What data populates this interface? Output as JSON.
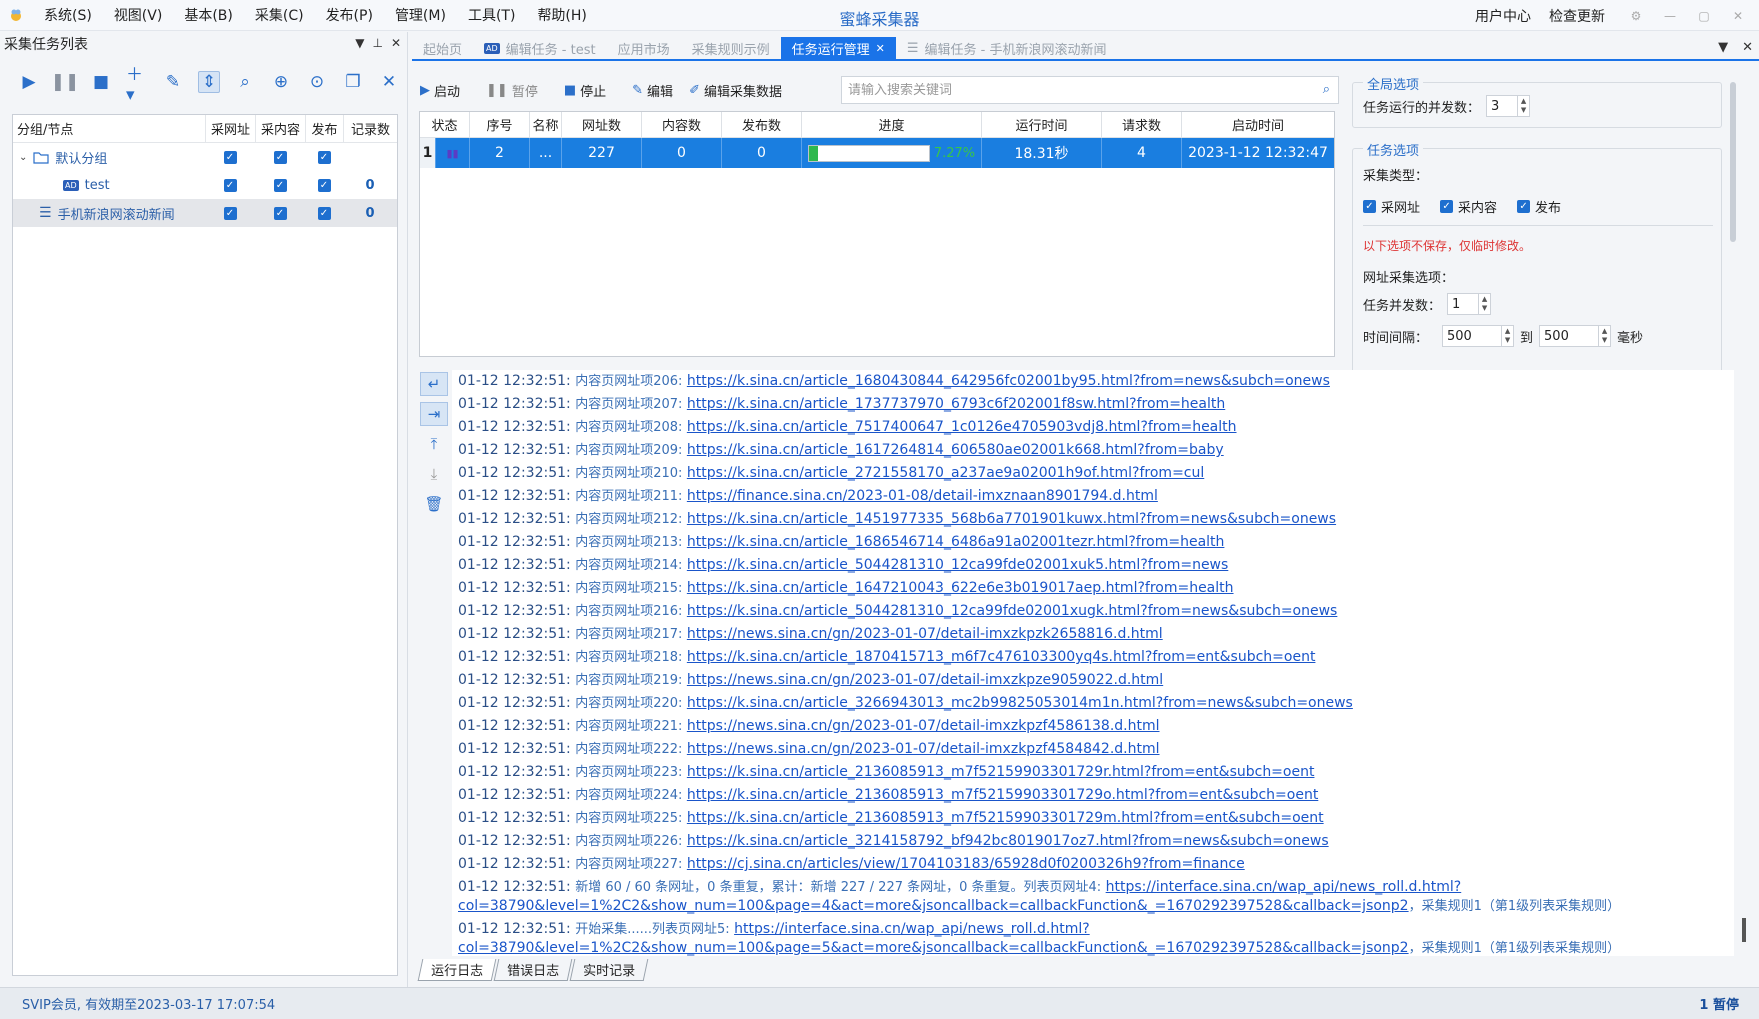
{
  "app": {
    "title": "蜜蜂采集器"
  },
  "menu": [
    "系统(S)",
    "视图(V)",
    "基本(B)",
    "采集(C)",
    "发布(P)",
    "管理(M)",
    "工具(T)",
    "帮助(H)"
  ],
  "title_links": {
    "user_center": "用户中心",
    "check_update": "检查更新"
  },
  "left": {
    "title": "采集任务列表",
    "tree_headers": {
      "node": "分组/节点",
      "url": "采网址",
      "content": "采内容",
      "publish": "发布",
      "records": "记录数"
    },
    "nodes": [
      {
        "name": "默认分组",
        "records": ""
      },
      {
        "name": "test",
        "records": "0"
      },
      {
        "name": "手机新浪网滚动新闻",
        "records": "0"
      }
    ]
  },
  "tabs": {
    "home": "起始页",
    "edit_test": "编辑任务 - test",
    "market": "应用市场",
    "examples": "采集规则示例",
    "runner": "任务运行管理",
    "edit_sina": "编辑任务 - 手机新浪网滚动新闻"
  },
  "task_toolbar": {
    "start": "启动",
    "pause": "暂停",
    "stop": "停止",
    "edit": "编辑",
    "edit_data": "编辑采集数据",
    "search_placeholder": "请输入搜索关键词"
  },
  "grid": {
    "headers": {
      "status": "状态",
      "seq": "序号",
      "name": "名称",
      "urls": "网址数",
      "contents": "内容数",
      "published": "发布数",
      "progress": "进度",
      "runtime": "运行时间",
      "requests": "请求数",
      "start_time": "启动时间"
    },
    "row": {
      "index": "1",
      "seq": "2",
      "name": "...",
      "urls": "227",
      "contents": "0",
      "published": "0",
      "progress_text": "7.27%",
      "progress_value": 7.27,
      "runtime": "18.31秒",
      "requests": "4",
      "start_time": "2023-1-12 12:32:47"
    }
  },
  "options": {
    "global_title": "全局选项",
    "concurrency_label": "任务运行的并发数：",
    "concurrency_value": "3",
    "task_title": "任务选项",
    "collect_type_label": "采集类型：",
    "chk_url": "采网址",
    "chk_content": "采内容",
    "chk_publish": "发布",
    "warning": "以下选项不保存，仅临时修改。",
    "url_options_label": "网址采集选项：",
    "task_concurrency_label": "任务并发数：",
    "task_concurrency_value": "1",
    "interval_label": "时间间隔：",
    "interval_from": "500",
    "to_label": "到",
    "interval_to": "500",
    "unit_label": "毫秒"
  },
  "log": {
    "lines": [
      {
        "time": "01-12 12:32:51:",
        "label": "内容页网址项206:",
        "url": "https://k.sina.cn/article_1680430844_642956fc02001by95.html?from=news&subch=onews"
      },
      {
        "time": "01-12 12:32:51:",
        "label": "内容页网址项207:",
        "url": "https://k.sina.cn/article_1737737970_6793c6f202001f8sw.html?from=health"
      },
      {
        "time": "01-12 12:32:51:",
        "label": "内容页网址项208:",
        "url": "https://k.sina.cn/article_7517400647_1c0126e4705903vdj8.html?from=health"
      },
      {
        "time": "01-12 12:32:51:",
        "label": "内容页网址项209:",
        "url": "https://k.sina.cn/article_1617264814_606580ae02001k668.html?from=baby"
      },
      {
        "time": "01-12 12:32:51:",
        "label": "内容页网址项210:",
        "url": "https://k.sina.cn/article_2721558170_a237ae9a02001h9of.html?from=cul"
      },
      {
        "time": "01-12 12:32:51:",
        "label": "内容页网址项211:",
        "url": "https://finance.sina.cn/2023-01-08/detail-imxznaan8901794.d.html"
      },
      {
        "time": "01-12 12:32:51:",
        "label": "内容页网址项212:",
        "url": "https://k.sina.cn/article_1451977335_568b6a7701901kuwx.html?from=news&subch=onews"
      },
      {
        "time": "01-12 12:32:51:",
        "label": "内容页网址项213:",
        "url": "https://k.sina.cn/article_1686546714_6486a91a02001tezr.html?from=health"
      },
      {
        "time": "01-12 12:32:51:",
        "label": "内容页网址项214:",
        "url": "https://k.sina.cn/article_5044281310_12ca99fde02001xuk5.html?from=news"
      },
      {
        "time": "01-12 12:32:51:",
        "label": "内容页网址项215:",
        "url": "https://k.sina.cn/article_1647210043_622e6e3b019017aep.html?from=health"
      },
      {
        "time": "01-12 12:32:51:",
        "label": "内容页网址项216:",
        "url": "https://k.sina.cn/article_5044281310_12ca99fde02001xugk.html?from=news&subch=onews"
      },
      {
        "time": "01-12 12:32:51:",
        "label": "内容页网址项217:",
        "url": "https://news.sina.cn/gn/2023-01-07/detail-imxzkpzk2658816.d.html"
      },
      {
        "time": "01-12 12:32:51:",
        "label": "内容页网址项218:",
        "url": "https://k.sina.cn/article_1870415713_m6f7c476103300yq4s.html?from=ent&subch=oent"
      },
      {
        "time": "01-12 12:32:51:",
        "label": "内容页网址项219:",
        "url": "https://news.sina.cn/gn/2023-01-07/detail-imxzkpze9059022.d.html"
      },
      {
        "time": "01-12 12:32:51:",
        "label": "内容页网址项220:",
        "url": "https://k.sina.cn/article_3266943013_mc2b99825053014m1n.html?from=news&subch=onews"
      },
      {
        "time": "01-12 12:32:51:",
        "label": "内容页网址项221:",
        "url": "https://news.sina.cn/gn/2023-01-07/detail-imxzkpzf4586138.d.html"
      },
      {
        "time": "01-12 12:32:51:",
        "label": "内容页网址项222:",
        "url": "https://news.sina.cn/gn/2023-01-07/detail-imxzkpzf4584842.d.html"
      },
      {
        "time": "01-12 12:32:51:",
        "label": "内容页网址项223:",
        "url": "https://k.sina.cn/article_2136085913_m7f52159903301729r.html?from=ent&subch=oent"
      },
      {
        "time": "01-12 12:32:51:",
        "label": "内容页网址项224:",
        "url": "https://k.sina.cn/article_2136085913_m7f52159903301729o.html?from=ent&subch=oent"
      },
      {
        "time": "01-12 12:32:51:",
        "label": "内容页网址项225:",
        "url": "https://k.sina.cn/article_2136085913_m7f52159903301729m.html?from=ent&subch=oent"
      },
      {
        "time": "01-12 12:32:51:",
        "label": "内容页网址项226:",
        "url": "https://k.sina.cn/article_3214158792_bf942bc8019017oz7.html?from=news&subch=onews"
      },
      {
        "time": "01-12 12:32:51:",
        "label": "内容页网址项227:",
        "url": "https://cj.sina.cn/articles/view/1704103183/65928d0f0200326h9?from=finance"
      }
    ],
    "summary1": {
      "time": "01-12 12:32:51:",
      "text": "新增 60 / 60 条网址，0 条重复，累计：新增 227 / 227 条网址，0 条重复。列表页网址4:",
      "url": "https://interface.sina.cn/wap_api/news_roll.d.html?col=38790&level=1%2C2&show_num=100&page=4&act=more&jsoncallback=callbackFunction&_=1670292397528&callback=jsonp2",
      "tail": "，采集规则1（第1级列表采集规则）"
    },
    "summary2": {
      "time": "01-12 12:32:51:",
      "text": "开始采集......列表页网址5:",
      "url": "https://interface.sina.cn/wap_api/news_roll.d.html?col=38790&level=1%2C2&show_num=100&page=5&act=more&jsoncallback=callbackFunction&_=1670292397528&callback=jsonp2",
      "tail": "，采集规则1（第1级列表采集规则）"
    }
  },
  "bottom_tabs": {
    "run_log": "运行日志",
    "error_log": "错误日志",
    "realtime": "实时记录"
  },
  "status": {
    "left": "SVIP会员, 有效期至2023-03-17 17:07:54",
    "right": "1 暂停"
  }
}
